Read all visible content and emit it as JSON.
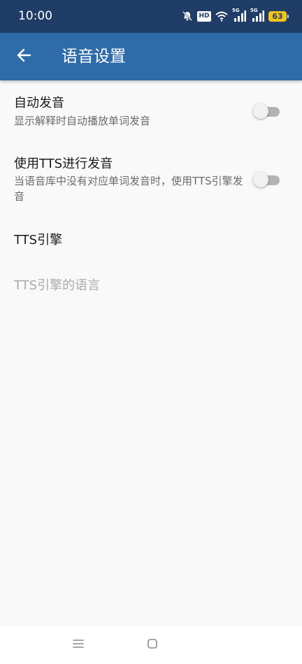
{
  "status_bar": {
    "time": "10:00",
    "hd_label": "HD",
    "network_label_1": "5G",
    "network_label_2": "5G",
    "battery_level": "63",
    "icons": [
      "bell-muted-icon",
      "hd-icon",
      "wifi-icon",
      "signal-icon",
      "signal-icon",
      "battery-icon"
    ],
    "battery_color": "#f5c518"
  },
  "app_bar": {
    "title": "语音设置",
    "back_icon": "arrow-left-icon",
    "color": "#2f6ba8"
  },
  "settings": [
    {
      "title": "自动发音",
      "summary": "显示解释时自动播放单词发音",
      "toggle_on": false,
      "enabled": true
    },
    {
      "title": "使用TTS进行发音",
      "summary": "当语音库中没有对应单词发音时，使用TTS引擎发音",
      "toggle_on": false,
      "enabled": true
    },
    {
      "title": "TTS引擎",
      "enabled": true
    },
    {
      "title": "TTS引擎的语言",
      "enabled": false
    }
  ],
  "nav_bar": {
    "icons": [
      "menu-icon",
      "home-square-icon"
    ]
  }
}
